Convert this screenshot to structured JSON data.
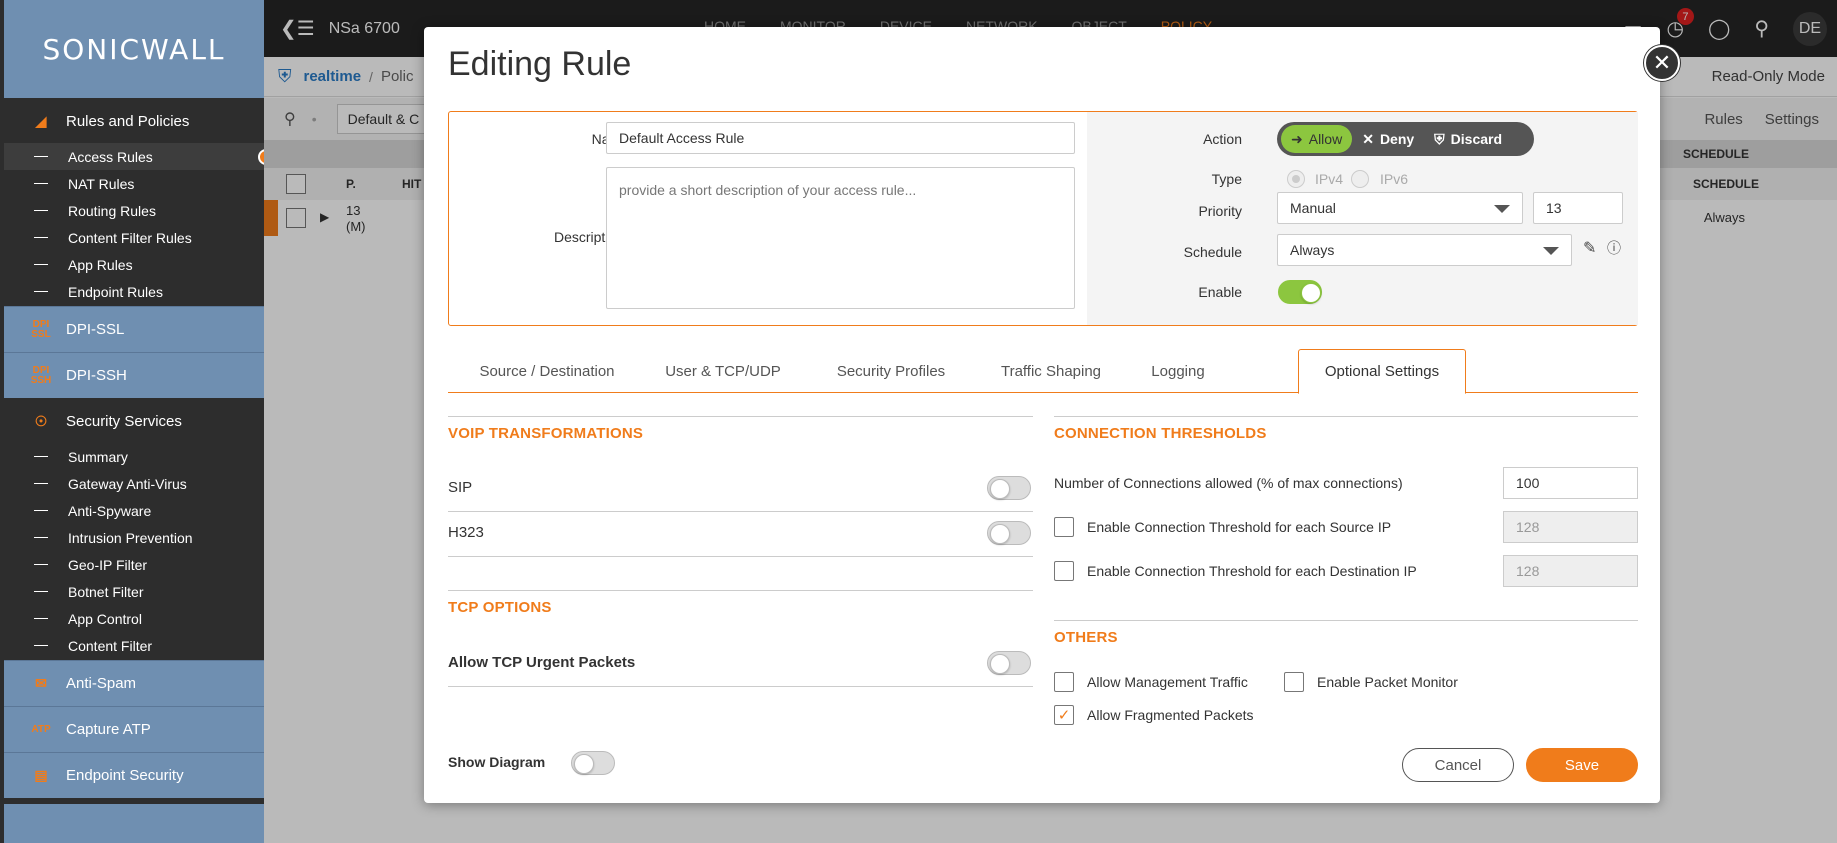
{
  "app": {
    "brand": "SONICWALL",
    "model": "NSa 6700",
    "top_nav": [
      "HOME",
      "MONITOR",
      "DEVICE",
      "NETWORK",
      "OBJECT",
      "POLICY"
    ],
    "notification_count": "7",
    "avatar": "DE",
    "breadcrumb": {
      "root": "realtime",
      "sep": "/",
      "current": "Polic"
    },
    "read_only": "Read-Only Mode",
    "toolbar": {
      "filter": "Default & C",
      "rules": "Rules",
      "settings": "Settings"
    },
    "grid": {
      "priority_col": "P.",
      "hits_col": "HIT",
      "schedule_col": "SCHEDULE",
      "row_priority": "13",
      "row_priority_sub": "(M)",
      "row_schedule": "Always"
    }
  },
  "sidebar": {
    "rules_section": "Rules and Policies",
    "rules_items": [
      "Access Rules",
      "NAT Rules",
      "Routing Rules",
      "Content Filter Rules",
      "App Rules",
      "Endpoint Rules"
    ],
    "dpi_ssl": "DPI-SSL",
    "dpi_ssl_icon": "DPI SSL",
    "dpi_ssh": "DPI-SSH",
    "dpi_ssh_icon": "DPI SSH",
    "security_section": "Security Services",
    "security_items": [
      "Summary",
      "Gateway Anti-Virus",
      "Anti-Spyware",
      "Intrusion Prevention",
      "Geo-IP Filter",
      "Botnet Filter",
      "App Control",
      "Content Filter"
    ],
    "anti_spam": "Anti-Spam",
    "capture_atp": "Capture ATP",
    "capture_atp_icon": "ATP",
    "endpoint_security": "Endpoint Security"
  },
  "modal": {
    "title": "Editing Rule",
    "name_label": "Name",
    "name_value": "Default Access Rule",
    "description_label": "Description",
    "description_placeholder": "provide a short description of your access rule...",
    "action_label": "Action",
    "action_options": [
      "Allow",
      "Deny",
      "Discard"
    ],
    "action_selected": "Allow",
    "type_label": "Type",
    "type_options": [
      "IPv4",
      "IPv6"
    ],
    "priority_label": "Priority",
    "priority_mode": "Manual",
    "priority_value": "13",
    "schedule_label": "Schedule",
    "schedule_value": "Always",
    "enable_label": "Enable",
    "enable_on": true,
    "tabs": [
      "Source / Destination",
      "User & TCP/UDP",
      "Security Profiles",
      "Traffic Shaping",
      "Logging",
      "Optional Settings"
    ],
    "active_tab": "Optional Settings",
    "voip": {
      "heading": "VOIP TRANSFORMATIONS",
      "sip_label": "SIP",
      "h323_label": "H323"
    },
    "tcp": {
      "heading": "TCP OPTIONS",
      "urgent_label": "Allow TCP Urgent Packets"
    },
    "connection": {
      "heading": "CONNECTION THRESHOLDS",
      "max_label": "Number of Connections allowed (% of max connections)",
      "max_value": "100",
      "source_label": "Enable Connection Threshold for each Source IP",
      "source_value": "128",
      "dest_label": "Enable Connection Threshold for each Destination IP",
      "dest_value": "128"
    },
    "others": {
      "heading": "OTHERS",
      "mgmt_label": "Allow Management Traffic",
      "packet_monitor_label": "Enable Packet Monitor",
      "fragmented_label": "Allow Fragmented Packets",
      "fragmented_checked": true
    },
    "show_diagram_label": "Show Diagram",
    "cancel_label": "Cancel",
    "save_label": "Save"
  },
  "colors": {
    "accent": "#f07c1b",
    "toggle_on": "#8cc63f",
    "sidebar_blue": "#6f8fb1",
    "link_blue": "#2a7cc7"
  }
}
